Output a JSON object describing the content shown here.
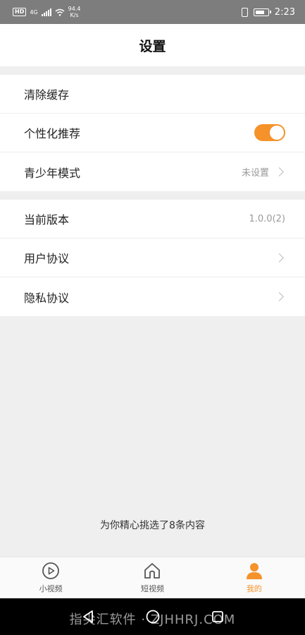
{
  "status_bar": {
    "hd_badge": "HD",
    "network": "4G",
    "speed_value": "94.4",
    "speed_unit": "K/s",
    "time": "2:23"
  },
  "header": {
    "title": "设置"
  },
  "settings": {
    "group1": [
      {
        "label": "清除缓存"
      },
      {
        "label": "个性化推荐",
        "toggle_on": true
      },
      {
        "label": "青少年模式",
        "value": "未设置"
      }
    ],
    "group2": [
      {
        "label": "当前版本",
        "value": "1.0.0(2)"
      },
      {
        "label": "用户协议"
      },
      {
        "label": "隐私协议"
      }
    ]
  },
  "footer_tip": "为你精心挑选了8条内容",
  "tab_bar": {
    "tabs": [
      {
        "label": "小视频",
        "icon": "play-circle-icon",
        "active": false
      },
      {
        "label": "短视频",
        "icon": "home-icon",
        "active": false
      },
      {
        "label": "我的",
        "icon": "user-icon",
        "active": true
      }
    ]
  },
  "watermark": "指尖汇软件 · ZJHHRJ.COM",
  "colors": {
    "accent": "#f5922a",
    "status_bar_bg": "#7d7d7d",
    "nav_bar_bg": "#000000"
  }
}
